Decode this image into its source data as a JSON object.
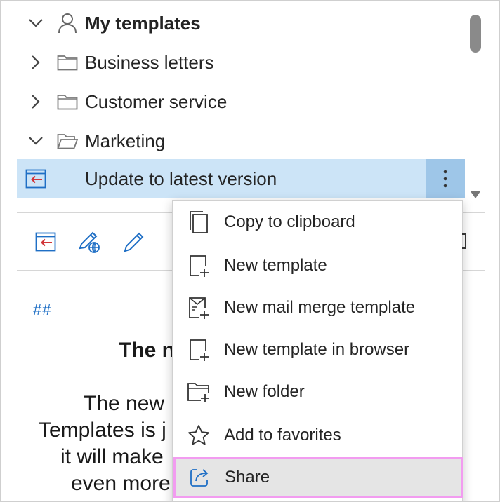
{
  "tree": {
    "root": {
      "label": "My templates",
      "icon": "person-icon",
      "expanded": true
    },
    "folders": [
      {
        "label": "Business letters",
        "icon": "folder-icon",
        "expanded": false
      },
      {
        "label": "Customer service",
        "icon": "folder-icon",
        "expanded": false
      },
      {
        "label": "Marketing",
        "icon": "folder-open-icon",
        "expanded": true
      }
    ],
    "selected_item": {
      "label": "Update to latest version",
      "icon": "template-insert-icon"
    }
  },
  "preview": {
    "hash": "##",
    "title": "The n",
    "lines": [
      "The new",
      "Templates is j",
      "it will make",
      "even more"
    ]
  },
  "context_menu": {
    "items": [
      {
        "label": "Copy to clipboard",
        "icon": "copy-icon"
      },
      {
        "label": "New template",
        "icon": "new-template-icon"
      },
      {
        "label": "New mail merge template",
        "icon": "mail-merge-icon"
      },
      {
        "label": "New template in browser",
        "icon": "new-template-browser-icon"
      },
      {
        "label": "New folder",
        "icon": "new-folder-icon"
      },
      {
        "label": "Add to favorites",
        "icon": "star-icon"
      },
      {
        "label": "Share",
        "icon": "share-icon",
        "highlighted": true
      }
    ]
  },
  "colors": {
    "selection": "#cce4f7",
    "more_button": "#9ec6e8",
    "accent_blue": "#1f6fc5",
    "accent_red": "#d13438",
    "share_highlight_border": "#f29cf0"
  }
}
